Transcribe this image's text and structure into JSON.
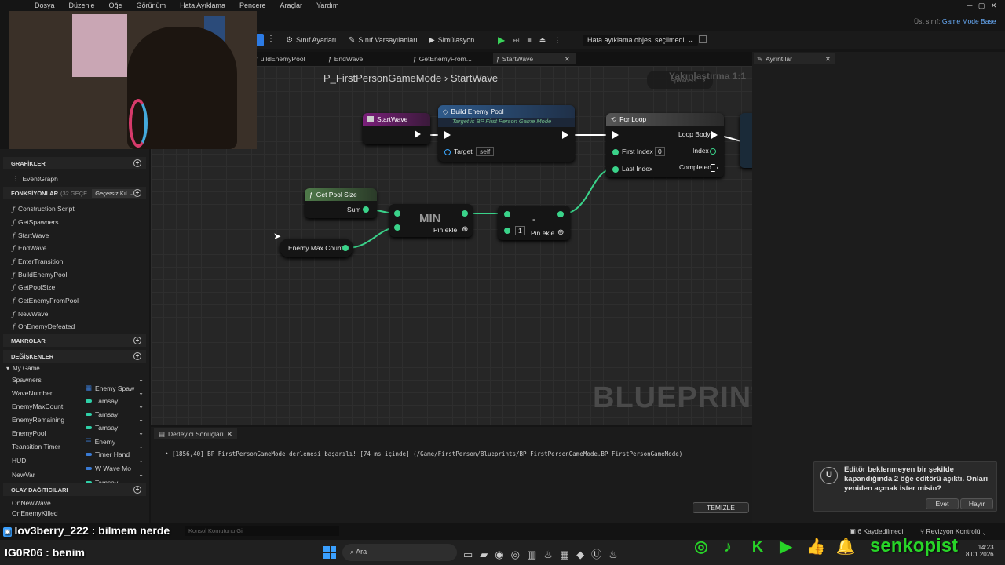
{
  "menubar": [
    "Dosya",
    "Düzenle",
    "Öğe",
    "Görünüm",
    "Hata Ayıklama",
    "Pencere",
    "Araçlar",
    "Yardım"
  ],
  "parent_class": {
    "label": "Üst sınıf:",
    "value": "Game Mode Base"
  },
  "toolbar": {
    "class_settings": "Sınıf Ayarları",
    "class_defaults": "Sınıf Varsayılanları",
    "simulation": "Simülasyon",
    "debug_object": "Hata ayıklama objesi seçilmedi"
  },
  "tabs": [
    {
      "label": "uildEnemyPool"
    },
    {
      "label": "EndWave"
    },
    {
      "label": "GetEnemyFrom..."
    },
    {
      "label": "StartWave",
      "active": true
    }
  ],
  "details_tab": "Ayrıntılar",
  "breadcrumb": {
    "root": "P_FirstPersonGameMode",
    "sep": "›",
    "current": "StartWave"
  },
  "zoom_label": "Yakınlaştırma 1:1",
  "spawners_node": "Spawners",
  "watermark": "BLUEPRINT",
  "nodes": {
    "start_wave": "StartWave",
    "build_enemy_pool": {
      "title": "Build Enemy Pool",
      "subtitle": "Target is BP First Person Game Mode",
      "target": "Target",
      "self": "self"
    },
    "for_loop": {
      "title": "For Loop",
      "first_index": "First Index",
      "first_index_val": "0",
      "last_index": "Last Index",
      "loop_body": "Loop Body",
      "index": "Index",
      "completed": "Completed"
    },
    "get_pool_size": {
      "title": "Get Pool Size",
      "sum": "Sum"
    },
    "enemy_max_count": "Enemy Max Count",
    "min": {
      "title": "MIN",
      "add_pin": "Pin ekle"
    },
    "subtract": {
      "title": "-",
      "value": "1",
      "add_pin": "Pin ekle"
    }
  },
  "sidebar": {
    "graphs": {
      "title": "GRAFİKLER",
      "items": [
        "EventGraph"
      ]
    },
    "functions": {
      "title": "FONKSİYONLAR",
      "count": "(32 GEÇE",
      "override": "Geçersiz Kıl",
      "items": [
        "Construction Script",
        "GetSpawners",
        "StartWave",
        "EndWave",
        "EnterTransition",
        "BuildEnemyPool",
        "GetPoolSize",
        "GetEnemyFromPool",
        "NewWave",
        "OnEnemyDefeated"
      ]
    },
    "macros": {
      "title": "MAKROLAR"
    },
    "variables": {
      "title": "DEĞİŞKENLER",
      "group": "My Game",
      "items": [
        {
          "name": "Spawners",
          "type": "Enemy Spaw",
          "color": "#3a7bd5"
        },
        {
          "name": "WaveNumber",
          "type": "Tamsayı",
          "color": "#2fd0a8"
        },
        {
          "name": "EnemyMaxCount",
          "type": "Tamsayı",
          "color": "#2fd0a8"
        },
        {
          "name": "EnemyRemaining",
          "type": "Tamsayı",
          "color": "#2fd0a8"
        },
        {
          "name": "EnemyPool",
          "type": "Enemy",
          "color": "#3a7bd5"
        },
        {
          "name": "Teansition Timer",
          "type": "Timer Hand",
          "color": "#3a7bd5"
        },
        {
          "name": "HUD",
          "type": "W Wave Mo",
          "color": "#3a7bd5"
        },
        {
          "name": "NewVar",
          "type": "Tamsayı",
          "color": "#2fd0a8"
        }
      ]
    },
    "dispatchers": {
      "title": "OLAY DAĞITICILARI",
      "items": [
        "OnNewWave",
        "OnEnemyKilled"
      ]
    }
  },
  "compiler": {
    "tab": "Derleyici Sonuçları",
    "message": "[1856,40] BP_FirstPersonGameMode derlemesi başarılı! [74 ms içinde] (/Game/FirstPerson/Blueprints/BP_FirstPersonGameMode.BP_FirstPersonGameMode)",
    "clear": "TEMİZLE"
  },
  "toast": {
    "message": "Editör beklenmeyen bir şekilde kapandığında 2 öğe editörü açıktı. Onları yeniden açmak ister misin?",
    "yes": "Evet",
    "no": "Hayır"
  },
  "statusbar": {
    "console": "Konsol Komutunu Gir",
    "saved": "6 Kaydedilmedi",
    "revision": "Revizyon Kontrolü"
  },
  "overlay": {
    "chat_line": "lov3berry_222 : bilmem nerde",
    "chat_line2": "IG0R06 : benim",
    "channel": "senkopist"
  },
  "taskbar": {
    "search": "Ara",
    "time": "14:23",
    "date": "8.01.2026"
  },
  "colors": {
    "accent": "#3a9ff5",
    "green_pin": "#3ad38a",
    "social_green": "#28d428"
  }
}
